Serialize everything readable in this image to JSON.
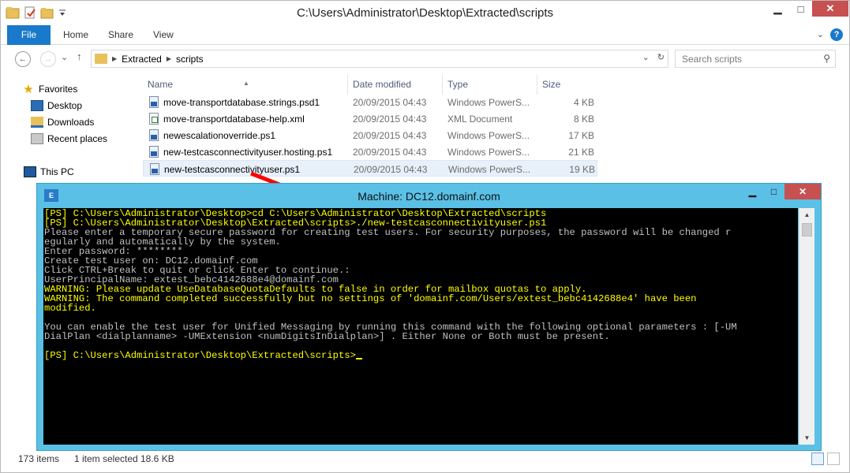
{
  "explorer": {
    "title": "C:\\Users\\Administrator\\Desktop\\Extracted\\scripts",
    "ribbon_tabs": [
      "File",
      "Home",
      "Share",
      "View"
    ],
    "address": {
      "segments": [
        "Extracted",
        "scripts"
      ]
    },
    "search_placeholder": "Search scripts",
    "nav_pane": {
      "favorites": "Favorites",
      "items": [
        "Desktop",
        "Downloads",
        "Recent places"
      ],
      "this_pc": "This PC"
    },
    "columns": [
      "Name",
      "Date modified",
      "Type",
      "Size"
    ],
    "files": [
      {
        "name": "move-transportdatabase.strings.psd1",
        "date": "20/09/2015 04:43",
        "type": "Windows PowerS...",
        "size": "4 KB",
        "icon": "powershell-file-icon"
      },
      {
        "name": "move-transportdatabase-help.xml",
        "date": "20/09/2015 04:43",
        "type": "XML Document",
        "size": "8 KB",
        "icon": "xml-file-icon"
      },
      {
        "name": "newescalationoverride.ps1",
        "date": "20/09/2015 04:43",
        "type": "Windows PowerS...",
        "size": "17 KB",
        "icon": "powershell-file-icon"
      },
      {
        "name": "new-testcasconnectivityuser.hosting.ps1",
        "date": "20/09/2015 04:43",
        "type": "Windows PowerS...",
        "size": "21 KB",
        "icon": "powershell-file-icon"
      },
      {
        "name": "new-testcasconnectivityuser.ps1",
        "date": "20/09/2015 04:43",
        "type": "Windows PowerS...",
        "size": "19 KB",
        "icon": "powershell-file-icon",
        "selected": true
      }
    ],
    "status": {
      "count": "173 items",
      "selected": "1 item selected",
      "size": "18.6 KB"
    }
  },
  "console": {
    "title": "Machine: DC12.domainf.com",
    "icon_label": "E",
    "lines": [
      {
        "text": "[PS] C:\\Users\\Administrator\\Desktop>cd C:\\Users\\Administrator\\Desktop\\Extracted\\scripts",
        "color": "yellow"
      },
      {
        "text": "[PS] C:\\Users\\Administrator\\Desktop\\Extracted\\scripts>./new-testcasconnectivityuser.ps1",
        "color": "yellow"
      },
      {
        "text": "Please enter a temporary secure password for creating test users. For security purposes, the password will be changed r",
        "color": "gray"
      },
      {
        "text": "egularly and automatically by the system.",
        "color": "gray"
      },
      {
        "text": "Enter password: ********",
        "color": "gray"
      },
      {
        "text": "Create test user on: DC12.domainf.com",
        "color": "gray"
      },
      {
        "text": "Click CTRL+Break to quit or click Enter to continue.:",
        "color": "gray"
      },
      {
        "text": "UserPrincipalName: extest_bebc4142688e4@domainf.com",
        "color": "gray"
      },
      {
        "text": "WARNING: Please update UseDatabaseQuotaDefaults to false in order for mailbox quotas to apply.",
        "color": "yellow"
      },
      {
        "text": "WARNING: The command completed successfully but no settings of 'domainf.com/Users/extest_bebc4142688e4' have been",
        "color": "yellow"
      },
      {
        "text": "modified.",
        "color": "yellow"
      },
      {
        "text": "",
        "color": "gray"
      },
      {
        "text": "You can enable the test user for Unified Messaging by running this command with the following optional parameters : [-UM",
        "color": "gray"
      },
      {
        "text": "DialPlan <dialplanname> -UMExtension <numDigitsInDialplan>] . Either None or Both must be present.",
        "color": "gray"
      },
      {
        "text": "",
        "color": "gray"
      },
      {
        "text": "[PS] C:\\Users\\Administrator\\Desktop\\Extracted\\scripts>",
        "color": "yellow",
        "cursor": true
      }
    ]
  },
  "colors": {
    "console_frame": "#5bc0e6",
    "console_yellow": "#ffff00",
    "console_gray": "#c0c0c0",
    "close_red": "#c75050",
    "ribbon_blue": "#1979ca",
    "arrow_red": "#ff0000"
  }
}
